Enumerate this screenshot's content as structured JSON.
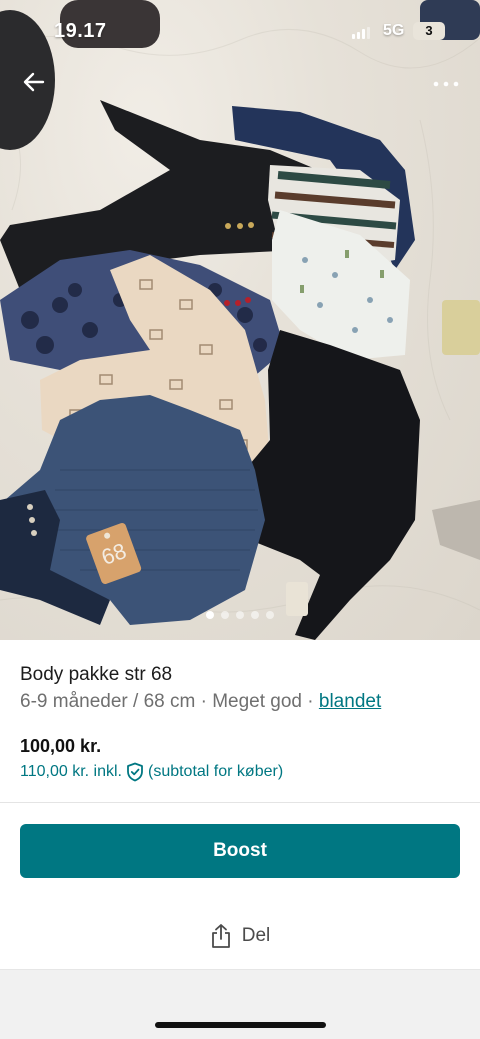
{
  "status_bar": {
    "time": "19.17",
    "network": "5G",
    "battery": "3"
  },
  "photo": {
    "tag_number": "68",
    "active_index": 0,
    "count": 5
  },
  "listing": {
    "title": "Body pakke str 68",
    "size": "6-9 måneder / 68 cm",
    "separator": "·",
    "condition": "Meget god",
    "brand": "blandet",
    "price": "100,00 kr.",
    "price_incl": "110,00 kr. inkl.",
    "price_incl_note": "(subtotal for køber)"
  },
  "actions": {
    "boost_label": "Boost",
    "share_label": "Del"
  },
  "colors": {
    "accent": "#007782"
  },
  "icons": {
    "back": "arrow-left-icon",
    "more": "more-dots-icon",
    "shield": "shield-check-icon",
    "share": "share-icon"
  }
}
